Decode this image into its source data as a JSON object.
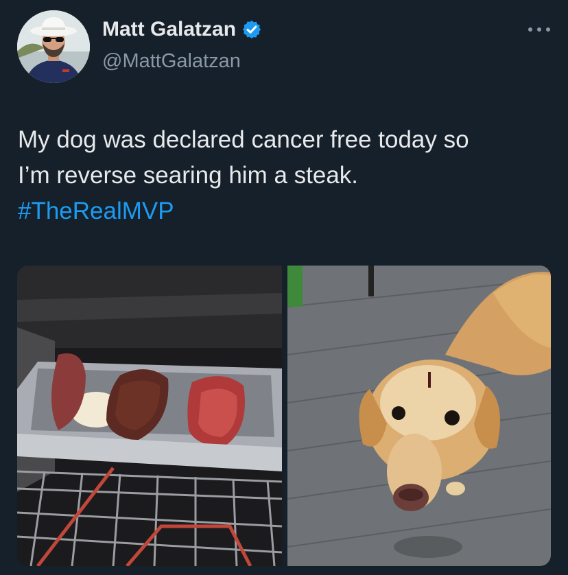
{
  "author": {
    "display_name": "Matt Galatzan",
    "handle": "@MattGalatzan",
    "verified": true,
    "avatar_icon": "avatar-photo"
  },
  "menu": {
    "icon": "more-options-icon"
  },
  "tweet": {
    "line1": "My dog was declared cancer free today so",
    "line2": "I’m reverse searing him a steak.",
    "hashtag": "#TheRealMVP"
  },
  "media": {
    "photo_left": "oven-steaks-photo",
    "photo_right": "golden-retriever-photo"
  },
  "colors": {
    "background": "#15202b",
    "text": "#e7e9ea",
    "secondary_text": "#8b98a5",
    "link": "#1d9bf0",
    "verified_badge": "#1d9bf0"
  }
}
